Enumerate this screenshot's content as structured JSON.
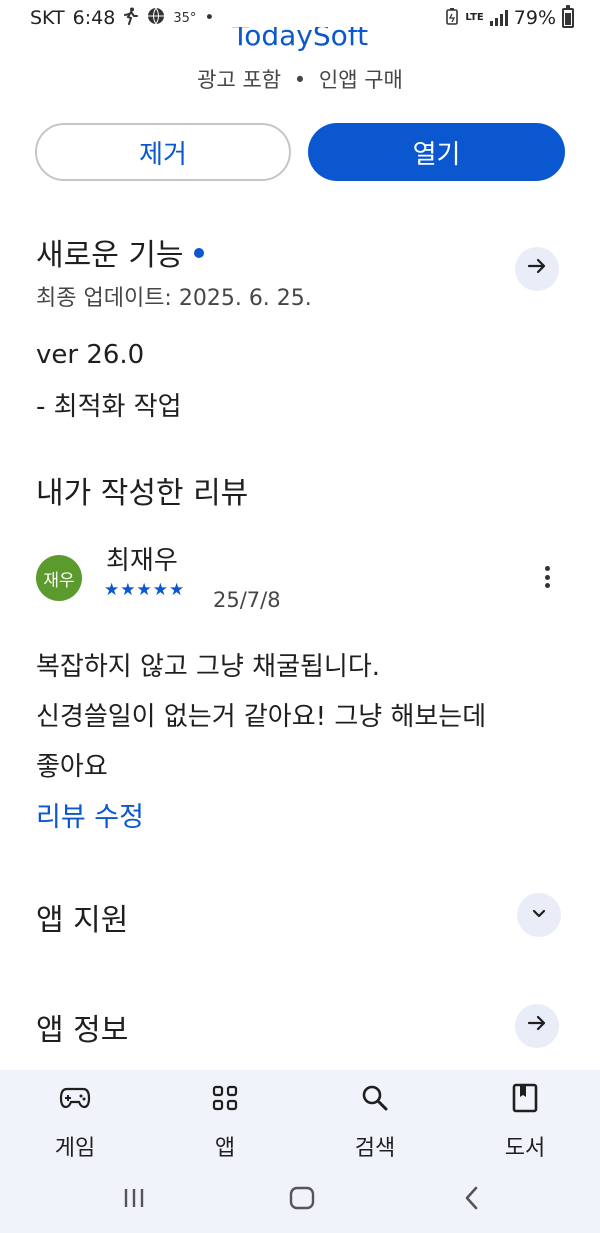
{
  "status_bar": {
    "carrier": "SKT",
    "time": "6:48",
    "temperature": "35°",
    "network": "LTE",
    "battery": "79%"
  },
  "app": {
    "name": "TodaySoft",
    "meta_ads": "광고 포함",
    "meta_separator": "•",
    "meta_iap": "인앱 구매"
  },
  "actions": {
    "remove_label": "제거",
    "open_label": "열기"
  },
  "whats_new": {
    "title": "새로운 기능",
    "last_updated": "최종 업데이트: 2025. 6. 25.",
    "version": "ver 26.0",
    "notes": "- 최적화 작업"
  },
  "my_review": {
    "title": "내가 작성한 리뷰",
    "avatar_text": "재우",
    "avatar_color": "#5b9a2d",
    "reviewer": "최재우",
    "stars": "★★★★★",
    "rating": 5,
    "date": "25/7/8",
    "text_lines": [
      "복잡하지 않고 그냥 채굴됩니다.",
      "신경쓸일이 없는거 같아요! 그냥 해보는데",
      "좋아요"
    ],
    "edit_label": "리뷰 수정"
  },
  "sections": {
    "app_support": "앱 지원",
    "app_info": "앱 정보"
  },
  "bottom_nav": {
    "items": [
      {
        "label": "게임",
        "icon": "gamepad-icon"
      },
      {
        "label": "앱",
        "icon": "apps-grid-icon"
      },
      {
        "label": "검색",
        "icon": "search-icon"
      },
      {
        "label": "도서",
        "icon": "book-icon"
      }
    ]
  },
  "colors": {
    "accent": "#0b57d0",
    "nav_background": "#f0f3f9"
  }
}
